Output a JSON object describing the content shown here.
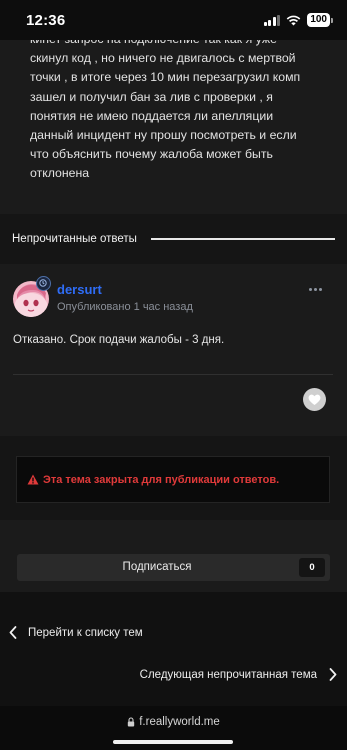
{
  "status_bar": {
    "time": "12:36",
    "battery": "100"
  },
  "post": {
    "lines": [
      "кинет запрос на подключение так как я уже",
      "скинул код , но ничего не двигалось с мертвой",
      "точки , в итоге через 10 мин перезагрузил комп",
      "зашел и получил бан за лив с проверки , я",
      "понятия не имею поддается ли апелляции",
      "данный инцидент ну прошу посмотреть и если",
      "что объяснить почему жалоба может быть",
      "отклонена"
    ]
  },
  "unread": {
    "label": "Непрочитанные ответы"
  },
  "answer": {
    "author": "dersurt",
    "published": "Опубликовано 1 час назад",
    "text": "Отказано. Срок подачи жалобы - 3 дня."
  },
  "locked": {
    "icon": "warning-icon",
    "text": "Эта тема закрыта для публикации ответов."
  },
  "subscribe": {
    "label": "Подписаться",
    "count": "0"
  },
  "navigation": {
    "back_label": "Перейти к списку тем",
    "next_label": "Следующая непрочитанная тема"
  },
  "browser": {
    "url": "f.reallyworld.me"
  },
  "colors": {
    "accent": "#2f6df6",
    "error": "#e03a3a",
    "background": "#1b1b1b"
  }
}
